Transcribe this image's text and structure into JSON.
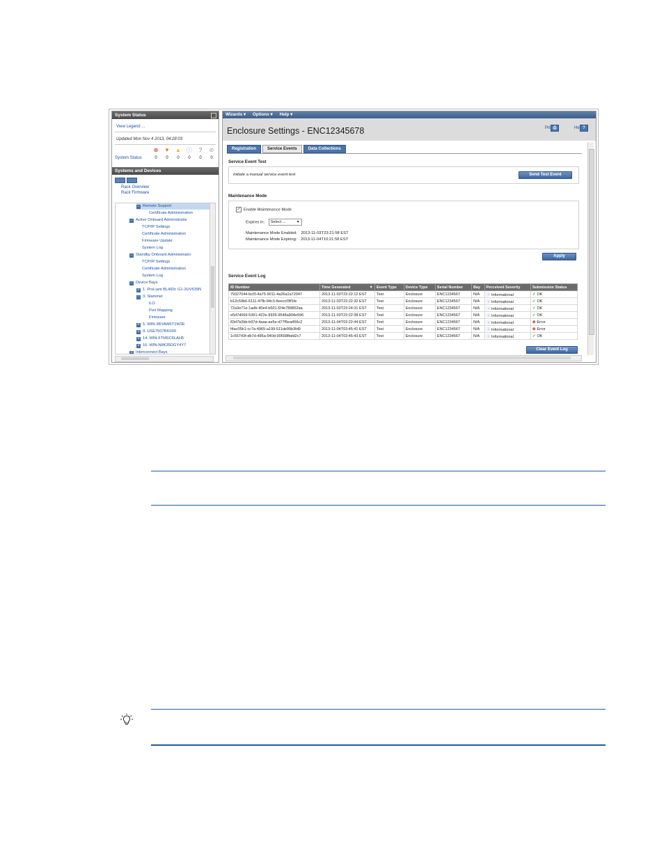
{
  "status_panel": {
    "title": "System Status",
    "view_legend": "View Legend ...",
    "updated": "Updated Mon Nov 4 2013, 04:28:03",
    "label": "System Status",
    "counts": [
      "0",
      "0",
      "0",
      "0",
      "0",
      "0"
    ]
  },
  "systems_panel": {
    "title": "Systems and Devices",
    "rack_overview": "Rack Overview",
    "rack_firmware": "Rack Firmware",
    "tree": [
      {
        "label": "Remote Support",
        "indent": 30,
        "toggle": "−",
        "selected": true
      },
      {
        "label": "Certificate Administration",
        "indent": 48,
        "toggle": "",
        "selected": false
      },
      {
        "label": "Active Onboard Administrator",
        "indent": 20,
        "toggle": "−",
        "selected": false
      },
      {
        "label": "TCP/IP Settings",
        "indent": 38,
        "toggle": "",
        "selected": false
      },
      {
        "label": "Certificate Administration",
        "indent": 38,
        "toggle": "",
        "selected": false
      },
      {
        "label": "Firmware Update",
        "indent": 38,
        "toggle": "",
        "selected": false
      },
      {
        "label": "System Log",
        "indent": 38,
        "toggle": "",
        "selected": false
      },
      {
        "label": "Standby Onboard Administrator",
        "indent": 20,
        "toggle": "−",
        "selected": false
      },
      {
        "label": "TCP/IP Settings",
        "indent": 38,
        "toggle": "",
        "selected": false
      },
      {
        "label": "Certificate Administration",
        "indent": 38,
        "toggle": "",
        "selected": false
      },
      {
        "label": "System Log",
        "indent": 38,
        "toggle": "",
        "selected": false
      },
      {
        "label": "Device Bays",
        "indent": 20,
        "toggle": "−",
        "selected": false
      },
      {
        "label": "1. ProLiant BL460c G1-3UV539N",
        "indent": 30,
        "toggle": "+",
        "selected": false
      },
      {
        "label": "3. Slammer",
        "indent": 30,
        "toggle": "−",
        "selected": false
      },
      {
        "label": "iLO",
        "indent": 48,
        "toggle": "",
        "selected": false
      },
      {
        "label": "Port Mapping",
        "indent": 48,
        "toggle": "",
        "selected": false
      },
      {
        "label": "Firmware",
        "indent": 48,
        "toggle": "",
        "selected": false
      },
      {
        "label": "5. WIN-3BYAW6T1W2E",
        "indent": 30,
        "toggle": "+",
        "selected": false
      },
      {
        "label": "9. USE7507R6S00",
        "indent": 30,
        "toggle": "+",
        "selected": false
      },
      {
        "label": "14. WIN-6TMSC6LAH5",
        "indent": 30,
        "toggle": "+",
        "selected": false
      },
      {
        "label": "16. WIN-N8K35DGY4Y7",
        "indent": 30,
        "toggle": "+",
        "selected": false
      },
      {
        "label": "Interconnect Bays",
        "indent": 20,
        "toggle": "+",
        "selected": false
      }
    ]
  },
  "menu": {
    "wizards": "Wizards ▾",
    "options": "Options ▾",
    "help": "Help ▾"
  },
  "page": {
    "title": "Enclosure Settings - ENC12345678",
    "print": "Print",
    "help": "Help",
    "tabs": [
      "Registration",
      "Service Events",
      "Data Collections"
    ],
    "active_tab": "Service Events"
  },
  "service_event_test": {
    "title": "Service Event Test",
    "desc": "Initiate a manual service event test",
    "button": "Send Test Event"
  },
  "maintenance": {
    "title": "Maintenance Mode",
    "enable_label": "Enable Maintenance Mode",
    "expires_label": "Expires in:",
    "expires_value": "Select ...",
    "enabled_label": "Maintenance Mode Enabled:",
    "enabled_value": "2013-11-03T23:21:58 EST",
    "expiring_label": "Maintenance Mode Expiring:",
    "expiring_value": "2013-11-04T10:21:58 EST",
    "apply": "Apply"
  },
  "log": {
    "title": "Service Event Log",
    "columns": [
      "ID Number",
      "Time Generated",
      "Event Type",
      "Device Type",
      "Serial Number",
      "Bay",
      "Perceived Severity",
      "Submission Status"
    ],
    "rows": [
      [
        "79327044-bcf3-4a75-9011-4a26a1a72047",
        "2013-11-03T23:22:12 EST",
        "Test",
        "Enclosure",
        "ENC1234567",
        "N/A",
        "Informational",
        "OK"
      ],
      [
        "b12c59b6-6111-47fb-94c3-8eeccf3ff1fe",
        "2013-11-03T23:22:32 EST",
        "Test",
        "Enclosure",
        "ENC1234567",
        "N/A",
        "Informational",
        "OK"
      ],
      [
        "72a3e71e-1adb-40e4-b501-f24e789852aa",
        "2013-11-03T23:24:31 EST",
        "Test",
        "Enclosure",
        "ENC1234567",
        "N/A",
        "Informational",
        "OK"
      ],
      [
        "e5d7d069-5391-422e-9935-9548a904e596",
        "2013-11-03T23:22:38 EST",
        "Test",
        "Enclosure",
        "ENC1234567",
        "N/A",
        "Informational",
        "OK"
      ],
      [
        "83d7b2bb-b97d-4aaa-ae5e-d77f5ea456c2",
        "2013-11-04T03:22:44 EST",
        "Test",
        "Enclosure",
        "ENC1234567",
        "N/A",
        "Informational",
        "Error"
      ],
      [
        "f4ac05b1-cc7a-4965-a199-511de90b3fd9",
        "2013-11-04T03:45:41 EST",
        "Test",
        "Enclosure",
        "ENC1234567",
        "N/A",
        "Informational",
        "Error"
      ],
      [
        "1c56743f-db7d-485a-940d-90658fbdd2c7",
        "2013-11-04T03:45:43 EST",
        "Test",
        "Enclosure",
        "ENC1234567",
        "N/A",
        "Informational",
        "OK"
      ]
    ],
    "clear_button": "Clear Event Log"
  }
}
